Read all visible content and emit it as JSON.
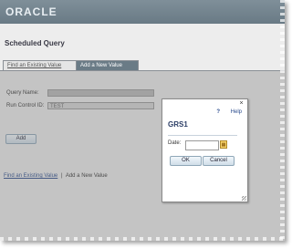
{
  "header": {
    "logo": "ORACLE"
  },
  "page": {
    "title": "Scheduled Query"
  },
  "tabs": [
    {
      "label": "Find an Existing Value",
      "active": false
    },
    {
      "label": "Add a New Value",
      "active": true
    }
  ],
  "form": {
    "query_name_label": "Query Name:",
    "query_name_value": "",
    "run_control_label": "Run Control ID:",
    "run_control_value": "TEST",
    "add_button": "Add"
  },
  "bottom_links": {
    "find_existing": "Find an Existing Value",
    "separator": "|",
    "add_new": "Add a New Value"
  },
  "modal": {
    "close_glyph": "×",
    "help_label": "Help",
    "help_icon": "?",
    "title": "GRS1",
    "date_label": "Date:",
    "date_value": "",
    "ok_button": "OK",
    "cancel_button": "Cancel"
  },
  "colors": {
    "header": "#6f808b",
    "active_tab": "#6a7b86",
    "modal_title": "#2c3e66",
    "link": "#2a4b8d"
  }
}
